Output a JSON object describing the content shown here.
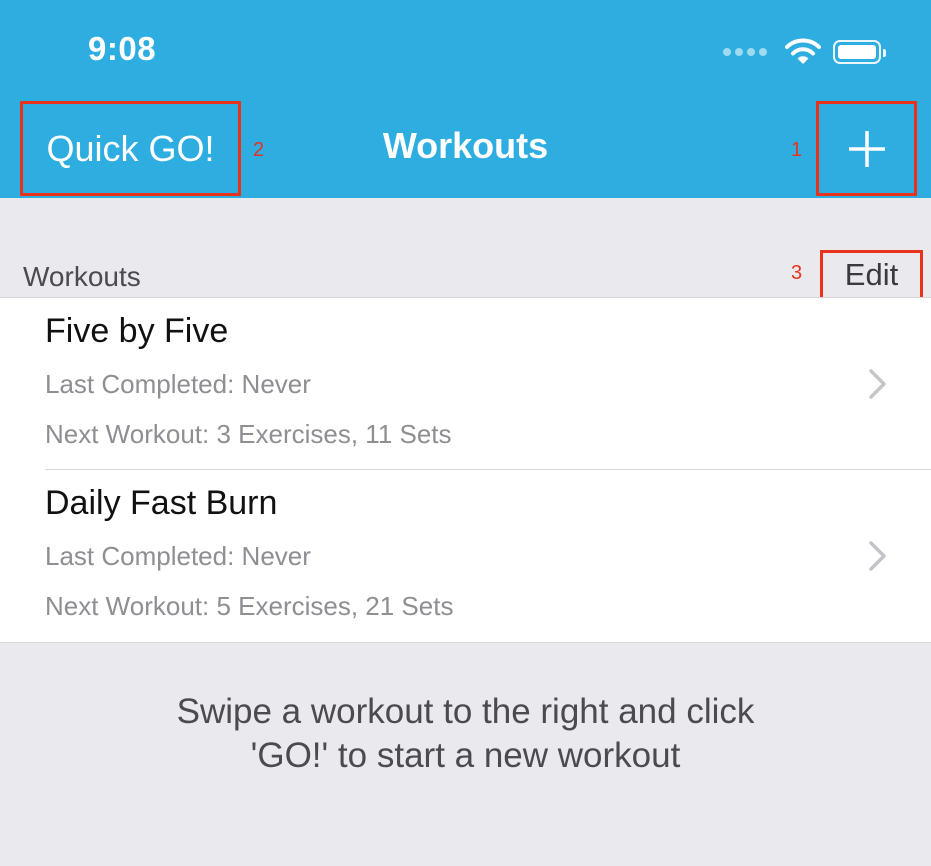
{
  "status_bar": {
    "time": "9:08"
  },
  "nav": {
    "left_button": "Quick GO!",
    "title": "Workouts",
    "right_button_icon": "plus-icon"
  },
  "markers": [
    "1",
    "2",
    "3"
  ],
  "section": {
    "title": "Workouts",
    "edit_label": "Edit"
  },
  "workouts": [
    {
      "name": "Five by Five",
      "last_completed": "Last Completed: Never",
      "next_workout": "Next Workout: 3 Exercises, 11 Sets"
    },
    {
      "name": "Daily Fast Burn",
      "last_completed": "Last Completed: Never",
      "next_workout": "Next Workout: 5 Exercises, 21 Sets"
    }
  ],
  "hint": {
    "line1": "Swipe a workout to the right and click",
    "line2": "'GO!' to start a new workout"
  },
  "colors": {
    "nav_background": "#2eade0",
    "annotation_red": "#e8321e",
    "page_background": "#e9e9ee"
  }
}
